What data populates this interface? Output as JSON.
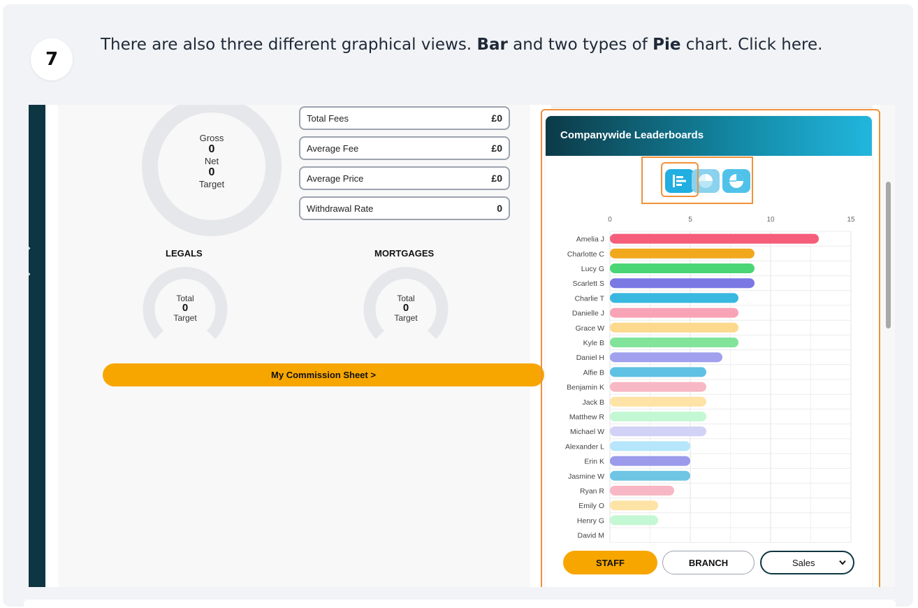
{
  "step": {
    "number": "7",
    "text_1": "There are also three different graphical views. ",
    "bold_1": "Bar",
    "text_2": " and two types of ",
    "bold_2": "Pie",
    "text_3": " chart. Click here."
  },
  "summary": {
    "gross_label": "Gross",
    "gross_value": "0",
    "net_label": "Net",
    "net_value": "0",
    "target_label": "Target"
  },
  "stats": [
    {
      "label": "Total Fees",
      "value": "£0"
    },
    {
      "label": "Average Fee",
      "value": "£0"
    },
    {
      "label": "Average Price",
      "value": "£0"
    },
    {
      "label": "Withdrawal Rate",
      "value": "0"
    }
  ],
  "legals": {
    "title": "LEGALS",
    "total_label": "Total",
    "total_value": "0",
    "target_label": "Target"
  },
  "mortgages": {
    "title": "MORTGAGES",
    "total_label": "Total",
    "total_value": "0",
    "target_label": "Target"
  },
  "commission_button": "My Commission Sheet >",
  "leaderboard": {
    "title": "Companywide Leaderboards",
    "views": [
      "bar-chart-icon",
      "pie-chart-icon",
      "pie-chart-alt-icon"
    ],
    "buttons": {
      "staff": "STAFF",
      "branch": "BRANCH"
    },
    "select": {
      "value": "Sales"
    }
  },
  "colors": {
    "accent_orange": "#f7a600",
    "header_dark": "#0c3a47",
    "header_light": "#22b6dd",
    "highlight": "#f0913a"
  },
  "chart_data": {
    "type": "bar",
    "orientation": "horizontal",
    "categories": [
      "Amelia J",
      "Charlotte C",
      "Lucy G",
      "Scarlett S",
      "Charlie T",
      "Danielle J",
      "Grace W",
      "Kyle B",
      "Daniel H",
      "Alfie B",
      "Benjamin K",
      "Jack B",
      "Matthew R",
      "Michael W",
      "Alexander L",
      "Erin K",
      "Jasmine W",
      "Ryan R",
      "Emily O",
      "Henry G",
      "David M"
    ],
    "values": [
      13,
      9,
      9,
      9,
      8,
      8,
      8,
      8,
      7,
      6,
      6,
      6,
      6,
      6,
      5,
      5,
      5,
      4,
      3,
      3,
      0
    ],
    "bar_colors": [
      "#f55d7b",
      "#f2a81d",
      "#4ad675",
      "#7a78e3",
      "#38b7e0",
      "#f9a3b7",
      "#fcd98c",
      "#82e39a",
      "#a0a0ee",
      "#5fc1e3",
      "#f8b7c4",
      "#fde3a6",
      "#c4f7d3",
      "#d2d2f6",
      "#b5e6fb",
      "#9b9aeb",
      "#6fc5e4",
      "#f8b7c4",
      "#fde3a6",
      "#c4f7d3",
      "#d2d2f6"
    ],
    "xlim": [
      0,
      15
    ],
    "xticks": [
      0,
      5,
      10,
      15
    ],
    "grid": true
  }
}
